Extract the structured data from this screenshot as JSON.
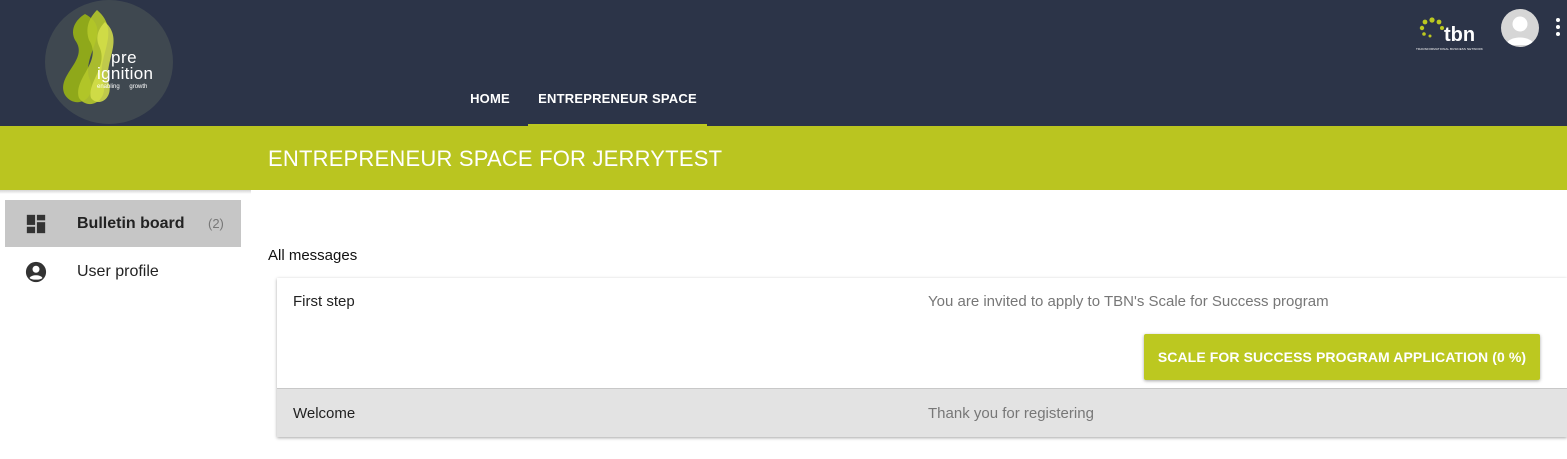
{
  "brand": {
    "logo_line1": "pre",
    "logo_line2": "ignition",
    "logo_tagline": "enabling growth",
    "partner_logo": "tbn",
    "partner_tagline": "TRANSFORMATIONAL BUSINESS NETWORK"
  },
  "nav": {
    "tabs": [
      {
        "label": "HOME",
        "active": false
      },
      {
        "label": "ENTREPRENEUR SPACE",
        "active": true
      }
    ]
  },
  "banner": {
    "title": "ENTREPRENEUR SPACE FOR JERRYTEST"
  },
  "sidebar": {
    "items": [
      {
        "label": "Bulletin board",
        "count": "(2)",
        "icon": "dashboard-icon",
        "active": true
      },
      {
        "label": "User profile",
        "count": "",
        "icon": "account-circle-icon",
        "active": false
      }
    ]
  },
  "main": {
    "section_label": "All messages",
    "messages": [
      {
        "title": "First step",
        "text": "You are invited to apply to TBN's Scale for Success program",
        "action": "SCALE FOR SUCCESS PROGRAM APPLICATION (0 %)"
      },
      {
        "title": "Welcome",
        "text": "Thank you for registering"
      }
    ]
  },
  "colors": {
    "header": "#2c3448",
    "accent": "#bac520",
    "selected": "#c6c6c6",
    "row_alt": "#e3e3e3"
  }
}
